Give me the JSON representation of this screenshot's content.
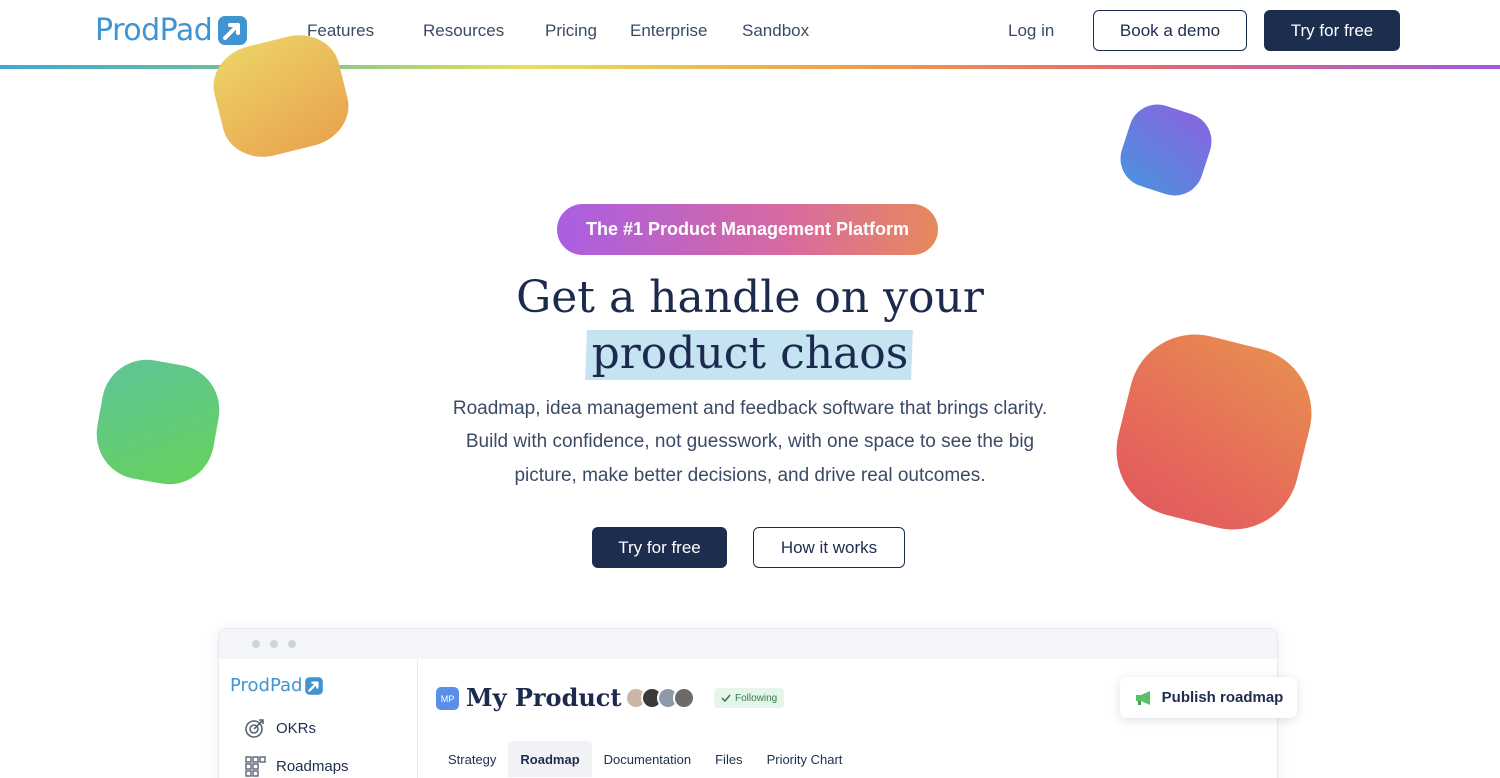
{
  "header": {
    "logo_text": "ProdPad",
    "nav": [
      "Features",
      "Resources",
      "Pricing",
      "Enterprise",
      "Sandbox"
    ],
    "login_label": "Log in",
    "book_demo_label": "Book a demo",
    "try_free_label": "Try for free"
  },
  "hero": {
    "badge": "The #1 Product Management Platform",
    "headline_line1": "Get a handle on your",
    "headline_line2": "product chaos",
    "subtitle_line1": "Roadmap, idea management and feedback software that brings clarity.",
    "subtitle_line2": "Build with confidence, not guesswork, with one space to see the big",
    "subtitle_line3": "picture, make better decisions, and drive real outcomes.",
    "primary_cta": "Try for free",
    "secondary_cta": "How it works"
  },
  "app_preview": {
    "logo_text": "ProdPad",
    "sidebar": [
      "OKRs",
      "Roadmaps"
    ],
    "product_badge": "MP",
    "product_title": "My Product",
    "following_label": "Following",
    "publish_label": "Publish roadmap",
    "tabs": [
      "Strategy",
      "Roadmap",
      "Documentation",
      "Files",
      "Priority Chart"
    ],
    "active_tab": "Roadmap"
  },
  "colors": {
    "brand_blue": "#3f94d1",
    "navy": "#1c2d4e",
    "highlight": "#c6e3f1"
  },
  "icons": [
    "prodpad-logo-icon",
    "okrs-icon",
    "roadmaps-icon",
    "megaphone-icon",
    "check-icon"
  ]
}
